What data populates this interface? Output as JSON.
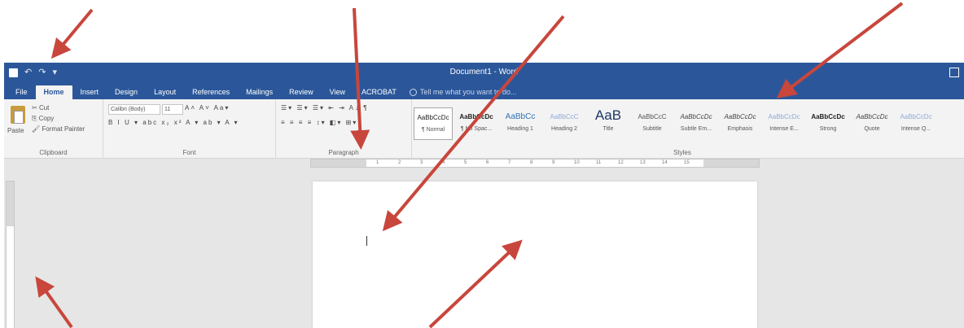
{
  "window": {
    "title": "Document1 - Word",
    "qat": {
      "undo": "↶",
      "redo": "↷",
      "more": "▾"
    }
  },
  "tabs": [
    "File",
    "Home",
    "Insert",
    "Design",
    "Layout",
    "References",
    "Mailings",
    "Review",
    "View",
    "ACROBAT"
  ],
  "active_tab": "Home",
  "tell_me": "Tell me what you want to do...",
  "clipboard": {
    "paste": "Paste",
    "cut": "Cut",
    "copy": "Copy",
    "format_painter": "Format Painter",
    "label": "Clipboard"
  },
  "font": {
    "family": "Calibri (Body)",
    "size": "11",
    "row1": "A˄ A˅ Aa▾",
    "row2": "B I U ▾ abc x₂ x²  A ▾ ab ▾ A ▾",
    "label": "Font"
  },
  "paragraph": {
    "row1": "☰▾ ☰▾ ☰▾  ⇤ ⇥  A↓ ¶",
    "row2": "≡ ≡ ≡ ≡  ↕▾  ◧▾  ⊞▾",
    "label": "Paragraph"
  },
  "styles": {
    "label": "Styles",
    "items": [
      {
        "sample": "AaBbCcDc",
        "name": "¶ Normal",
        "kind": "selected"
      },
      {
        "sample": "AaBbCcDc",
        "name": "¶ No Spac...",
        "kind": "s-bold"
      },
      {
        "sample": "AaBbCc",
        "name": "Heading 1",
        "kind": "s-blue"
      },
      {
        "sample": "AaBbCcC",
        "name": "Heading 2",
        "kind": "s-light"
      },
      {
        "sample": "AaB",
        "name": "Title",
        "kind": "s-big"
      },
      {
        "sample": "AaBbCcC",
        "name": "Subtitle",
        "kind": "s-gray"
      },
      {
        "sample": "AaBbCcDc",
        "name": "Subtle Em...",
        "kind": "s-italic"
      },
      {
        "sample": "AaBbCcDc",
        "name": "Emphasis",
        "kind": "s-italic"
      },
      {
        "sample": "AaBbCcDc",
        "name": "Intense E...",
        "kind": "s-light"
      },
      {
        "sample": "AaBbCcDc",
        "name": "Strong",
        "kind": "s-bold"
      },
      {
        "sample": "AaBbCcDc",
        "name": "Quote",
        "kind": "s-italic"
      },
      {
        "sample": "AaBbCcDc",
        "name": "Intense Q...",
        "kind": "s-light"
      }
    ]
  },
  "ruler_numbers": [
    "1",
    "2",
    "3",
    "4",
    "5",
    "6",
    "7",
    "8",
    "9",
    "10",
    "11",
    "12",
    "13",
    "14",
    "15"
  ],
  "colors": {
    "titlebar": "#2b579a",
    "ribbon": "#f3f3f3",
    "arrow": "#c8463c"
  }
}
